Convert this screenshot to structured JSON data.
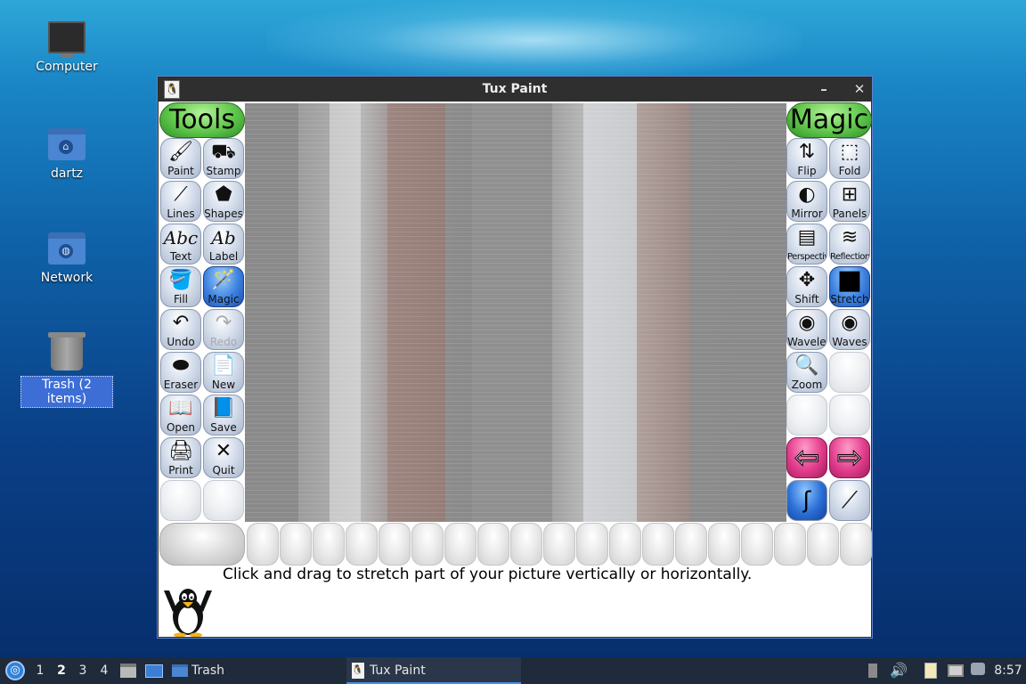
{
  "desktop": {
    "icons": [
      {
        "label": "Computer"
      },
      {
        "label": "dartz"
      },
      {
        "label": "Network"
      },
      {
        "label": "Trash (2 items)"
      }
    ]
  },
  "window": {
    "title": "Tux Paint",
    "minimize_symbol": "–",
    "close_symbol": "✕"
  },
  "left_panel": {
    "header": "Tools",
    "tools": [
      {
        "label": "Paint",
        "icon": "brush-icon",
        "glyph": "🖌"
      },
      {
        "label": "Stamp",
        "icon": "stamp-icon",
        "glyph": "⛟"
      },
      {
        "label": "Lines",
        "icon": "lines-icon",
        "glyph": "⟋"
      },
      {
        "label": "Shapes",
        "icon": "pentagon-icon",
        "glyph": "⬟"
      },
      {
        "label": "Text",
        "icon": "text-icon",
        "glyph": "Abc"
      },
      {
        "label": "Label",
        "icon": "label-icon",
        "glyph": "Ab"
      },
      {
        "label": "Fill",
        "icon": "bucket-icon",
        "glyph": "🪣"
      },
      {
        "label": "Magic",
        "icon": "magic-wand-icon",
        "glyph": "🪄"
      },
      {
        "label": "Undo",
        "icon": "undo-icon",
        "glyph": "↶"
      },
      {
        "label": "Redo",
        "icon": "redo-icon",
        "glyph": "↷"
      },
      {
        "label": "Eraser",
        "icon": "eraser-icon",
        "glyph": "⬬"
      },
      {
        "label": "New",
        "icon": "new-page-icon",
        "glyph": "📄"
      },
      {
        "label": "Open",
        "icon": "open-book-icon",
        "glyph": "📖"
      },
      {
        "label": "Save",
        "icon": "save-book-icon",
        "glyph": "📘"
      },
      {
        "label": "Print",
        "icon": "printer-icon",
        "glyph": "🖨"
      },
      {
        "label": "Quit",
        "icon": "quit-x-icon",
        "glyph": "✕"
      }
    ]
  },
  "right_panel": {
    "header": "Magic",
    "tools": [
      {
        "label": "Flip",
        "icon": "flip-icon",
        "glyph": "⇅"
      },
      {
        "label": "Fold",
        "icon": "fold-icon",
        "glyph": "⬚"
      },
      {
        "label": "Mirror",
        "icon": "mirror-icon",
        "glyph": "◐"
      },
      {
        "label": "Panels",
        "icon": "panels-icon",
        "glyph": "⊞"
      },
      {
        "label": "Perspective",
        "icon": "perspective-icon",
        "glyph": "▤"
      },
      {
        "label": "Reflection",
        "icon": "reflection-icon",
        "glyph": "≋"
      },
      {
        "label": "Shift",
        "icon": "shift-arrows-icon",
        "glyph": "✥"
      },
      {
        "label": "Stretch",
        "icon": "stretch-icon",
        "glyph": "■"
      },
      {
        "label": "Wavelets",
        "icon": "wavelets-icon",
        "glyph": "◉"
      },
      {
        "label": "Waves",
        "icon": "waves-icon",
        "glyph": "◉"
      },
      {
        "label": "Zoom",
        "icon": "zoom-icon",
        "glyph": "🔍"
      }
    ],
    "prev_page": "⇦",
    "next_page": "⇨",
    "mode_paint": "ʃ",
    "mode_fullscreen": "⟋"
  },
  "status": {
    "instruction": "Click and drag to stretch part of your picture vertically or horizontally."
  },
  "taskbar": {
    "menu_glyph": "◎",
    "workspaces": [
      "1",
      "2",
      "3",
      "4"
    ],
    "current_workspace": "2",
    "trash_task": "Trash",
    "active_task": "Tux Paint",
    "clock": "8:57"
  },
  "colors": {
    "titlebar": "#2f2f2f",
    "taskbar": "#1f2a3a",
    "header_green": "#5fc64a",
    "active_blue": "#3e82e0",
    "arrow_pink": "#e23d8c"
  }
}
